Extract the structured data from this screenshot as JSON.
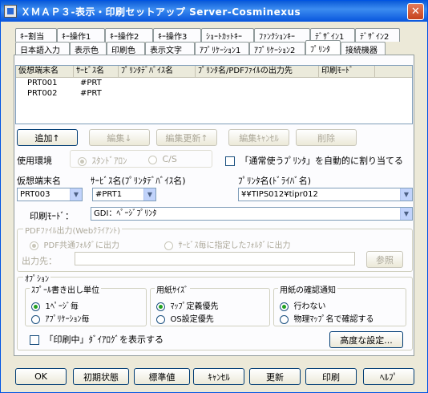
{
  "window": {
    "title": "ＸＭＡＰ３-表示・印刷セットアップ Server-Cosminexus",
    "close": "✕"
  },
  "tabs_row1": [
    "ｷｰ割当",
    "ｷｰ操作1",
    "ｷｰ操作2",
    "ｷｰ操作3",
    "ｼｮｰﾄｶｯﾄｷｰ",
    "ﾌｧﾝｸｼｮﾝｷｰ",
    "ﾃﾞｻﾞｲﾝ1",
    "ﾃﾞｻﾞｲﾝ2"
  ],
  "tabs_row2": [
    "日本語入力",
    "表示色",
    "印刷色",
    "表示文字",
    "ｱﾌﾟﾘｹｰｼｮﾝ1",
    "ｱﾌﾟﾘｹｰｼｮﾝ2",
    "ﾌﾟﾘﾝﾀ",
    "接続機器"
  ],
  "printer_list": {
    "columns": [
      "仮想端末名",
      "ｻｰﾋﾞｽ名",
      "ﾌﾟﾘﾝﾀﾃﾞﾊﾞｲｽ名",
      "ﾌﾟﾘﾝﾀ名/PDFﾌｧｲﾙの出力先",
      "印刷ﾓｰﾄﾞ"
    ],
    "rows": [
      [
        "PRT001",
        "#PRT"
      ],
      [
        "PRT002",
        "#PRT"
      ]
    ]
  },
  "list_buttons": {
    "add": "追加↑",
    "edit": "編集↓",
    "update": "編集更新↑",
    "cancel": "編集ｷｬﾝｾﾙ",
    "delete": "削除"
  },
  "env": {
    "label": "使用環境",
    "standalone": "ｽﾀﾝﾄﾞｱﾛﾝ",
    "cs": "C/S",
    "auto_assign": "「通常使うﾌﾟﾘﾝﾀ」を自動的に割り当てる"
  },
  "fields": {
    "terminal_label": "仮想端末名",
    "terminal_value": "PRT003",
    "service_label": "ｻｰﾋﾞｽ名(ﾌﾟﾘﾝﾀﾃﾞﾊﾞｲｽ名)",
    "service_value": "#PRT1",
    "printer_label": "ﾌﾟﾘﾝﾀ名(ﾄﾞﾗｲﾊﾞ名)",
    "printer_value": "¥¥TIPS012¥tipr012",
    "mode_label": "印刷ﾓｰﾄﾞ：",
    "mode_value": "GDI：ﾍﾟｰｼﾞﾌﾟﾘﾝﾀ"
  },
  "pdf": {
    "group": "PDFﾌｧｲﾙ出力(Webｸﾗｲｱﾝﾄ)",
    "common": "PDF共通ﾌｫﾙﾀﾞに出力",
    "per_service": "ｻｰﾋﾞｽ毎に指定したﾌｫﾙﾀﾞに出力",
    "dest_label": "出力先：",
    "browse": "参照"
  },
  "options": {
    "group": "ｵﾌﾟｼｮﾝ",
    "spool_group": "ｽﾌﾟｰﾙ書き出し単位",
    "spool_page": "1ﾍﾟｰｼﾞ毎",
    "spool_app": "ｱﾌﾟﾘｹｰｼｮﾝ毎",
    "size_group": "用紙ｻｲｽﾞ",
    "size_map": "ﾏｯﾌﾟ定義優先",
    "size_os": "OS設定優先",
    "confirm_group": "用紙の確認通知",
    "confirm_none": "行わない",
    "confirm_map": "物理ﾏｯﾌﾟ名で確認する",
    "show_dialog": "「印刷中」ﾀﾞｲｱﾛｸﾞを表示する",
    "advanced": "高度な設定..."
  },
  "footer": [
    "OK",
    "初期状態",
    "標準値",
    "ｷｬﾝｾﾙ",
    "更新",
    "印刷",
    "ﾍﾙﾌﾟ"
  ]
}
